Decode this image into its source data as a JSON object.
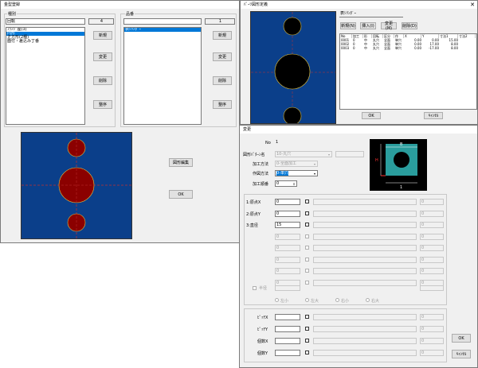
{
  "main": {
    "title": "金型登録",
    "kind_label": "種別",
    "kind_value": "回転",
    "kind_count": "4",
    "kind_items": [
      "ﾌﾗﾝｼﾞ座(3)",
      "円形",
      "正方形(2種)",
      "面付・差込み丁番"
    ],
    "kind_selected": 1,
    "name_label": "品番",
    "name_value": "",
    "name_count": "1",
    "name_items": [
      "表ｼﾘﾝﾀﾞｰ"
    ],
    "name_selected": 0,
    "btn_new1": "新規",
    "btn_edit1": "変更",
    "btn_del1": "削除",
    "btn_sort1": "整序",
    "btn_new2": "新規",
    "btn_edit2": "変更",
    "btn_del2": "削除",
    "btn_sort2": "整序",
    "btn_shape_edit": "図形編集",
    "btn_ok": "OK"
  },
  "shapewin": {
    "title": "ﾊﾟｰﾂ図形定義",
    "name_value": "表ｼﾘﾝﾀﾞｰ",
    "btn_new": "新規(N)",
    "btn_insert": "挿入(I)",
    "btn_edit": "変更(M)",
    "btn_delete": "削除(D)",
    "columns": [
      "No",
      "加工",
      "形",
      "回転",
      "区分",
      "作",
      "X",
      "Y",
      "寸法1",
      "寸法2"
    ],
    "rows": [
      [
        "0001",
        "0",
        "中",
        "丸穴",
        "全面",
        "単穴",
        "0.00",
        "0.00",
        "15.00",
        ""
      ],
      [
        "0002",
        "0",
        "中",
        "丸穴",
        "全面",
        "単穴",
        "0.00",
        "17.00",
        "8.00",
        ""
      ],
      [
        "0003",
        "0",
        "中",
        "丸穴",
        "全面",
        "単穴",
        "0.00",
        "-17.00",
        "8.00",
        ""
      ]
    ],
    "btn_ok": "OK",
    "btn_cancel": "ｷｬﾝｾﾙ"
  },
  "edit": {
    "title": "変更",
    "no_label": "No",
    "no_value": "1",
    "pattern_label": "図形ﾊﾟﾀｰﾝ名",
    "pattern_value": "10-丸穴",
    "method_label": "加工方法",
    "method_value": "0-全面加工",
    "draw_label": "作図方法",
    "draw_value": "0-単穴",
    "order_label": "加工順番",
    "order_value": "0",
    "param_labels": [
      "1:原点X",
      "2:原点Y",
      "3:直径"
    ],
    "param_values": [
      "0",
      "0",
      "15"
    ],
    "right_value": "0",
    "half_label": "半径",
    "radios": [
      "左小",
      "左大",
      "右小",
      "右大"
    ],
    "pitch_labels": [
      "ﾋﾟｯﾁX",
      "ﾋﾟｯﾁY",
      "個数X",
      "個数Y"
    ],
    "btn_ok": "OK",
    "btn_cancel": "ｷｬﾝｾﾙ",
    "preview_labels": {
      "top": "B",
      "left": "H",
      "bottom": "1"
    }
  },
  "colors": {
    "canvas_blue": "#0b3f8a",
    "hole_red": "#8b0000",
    "hole_black": "#000000",
    "preview_teal": "#2a9d9d",
    "selection": "#0078d7"
  }
}
